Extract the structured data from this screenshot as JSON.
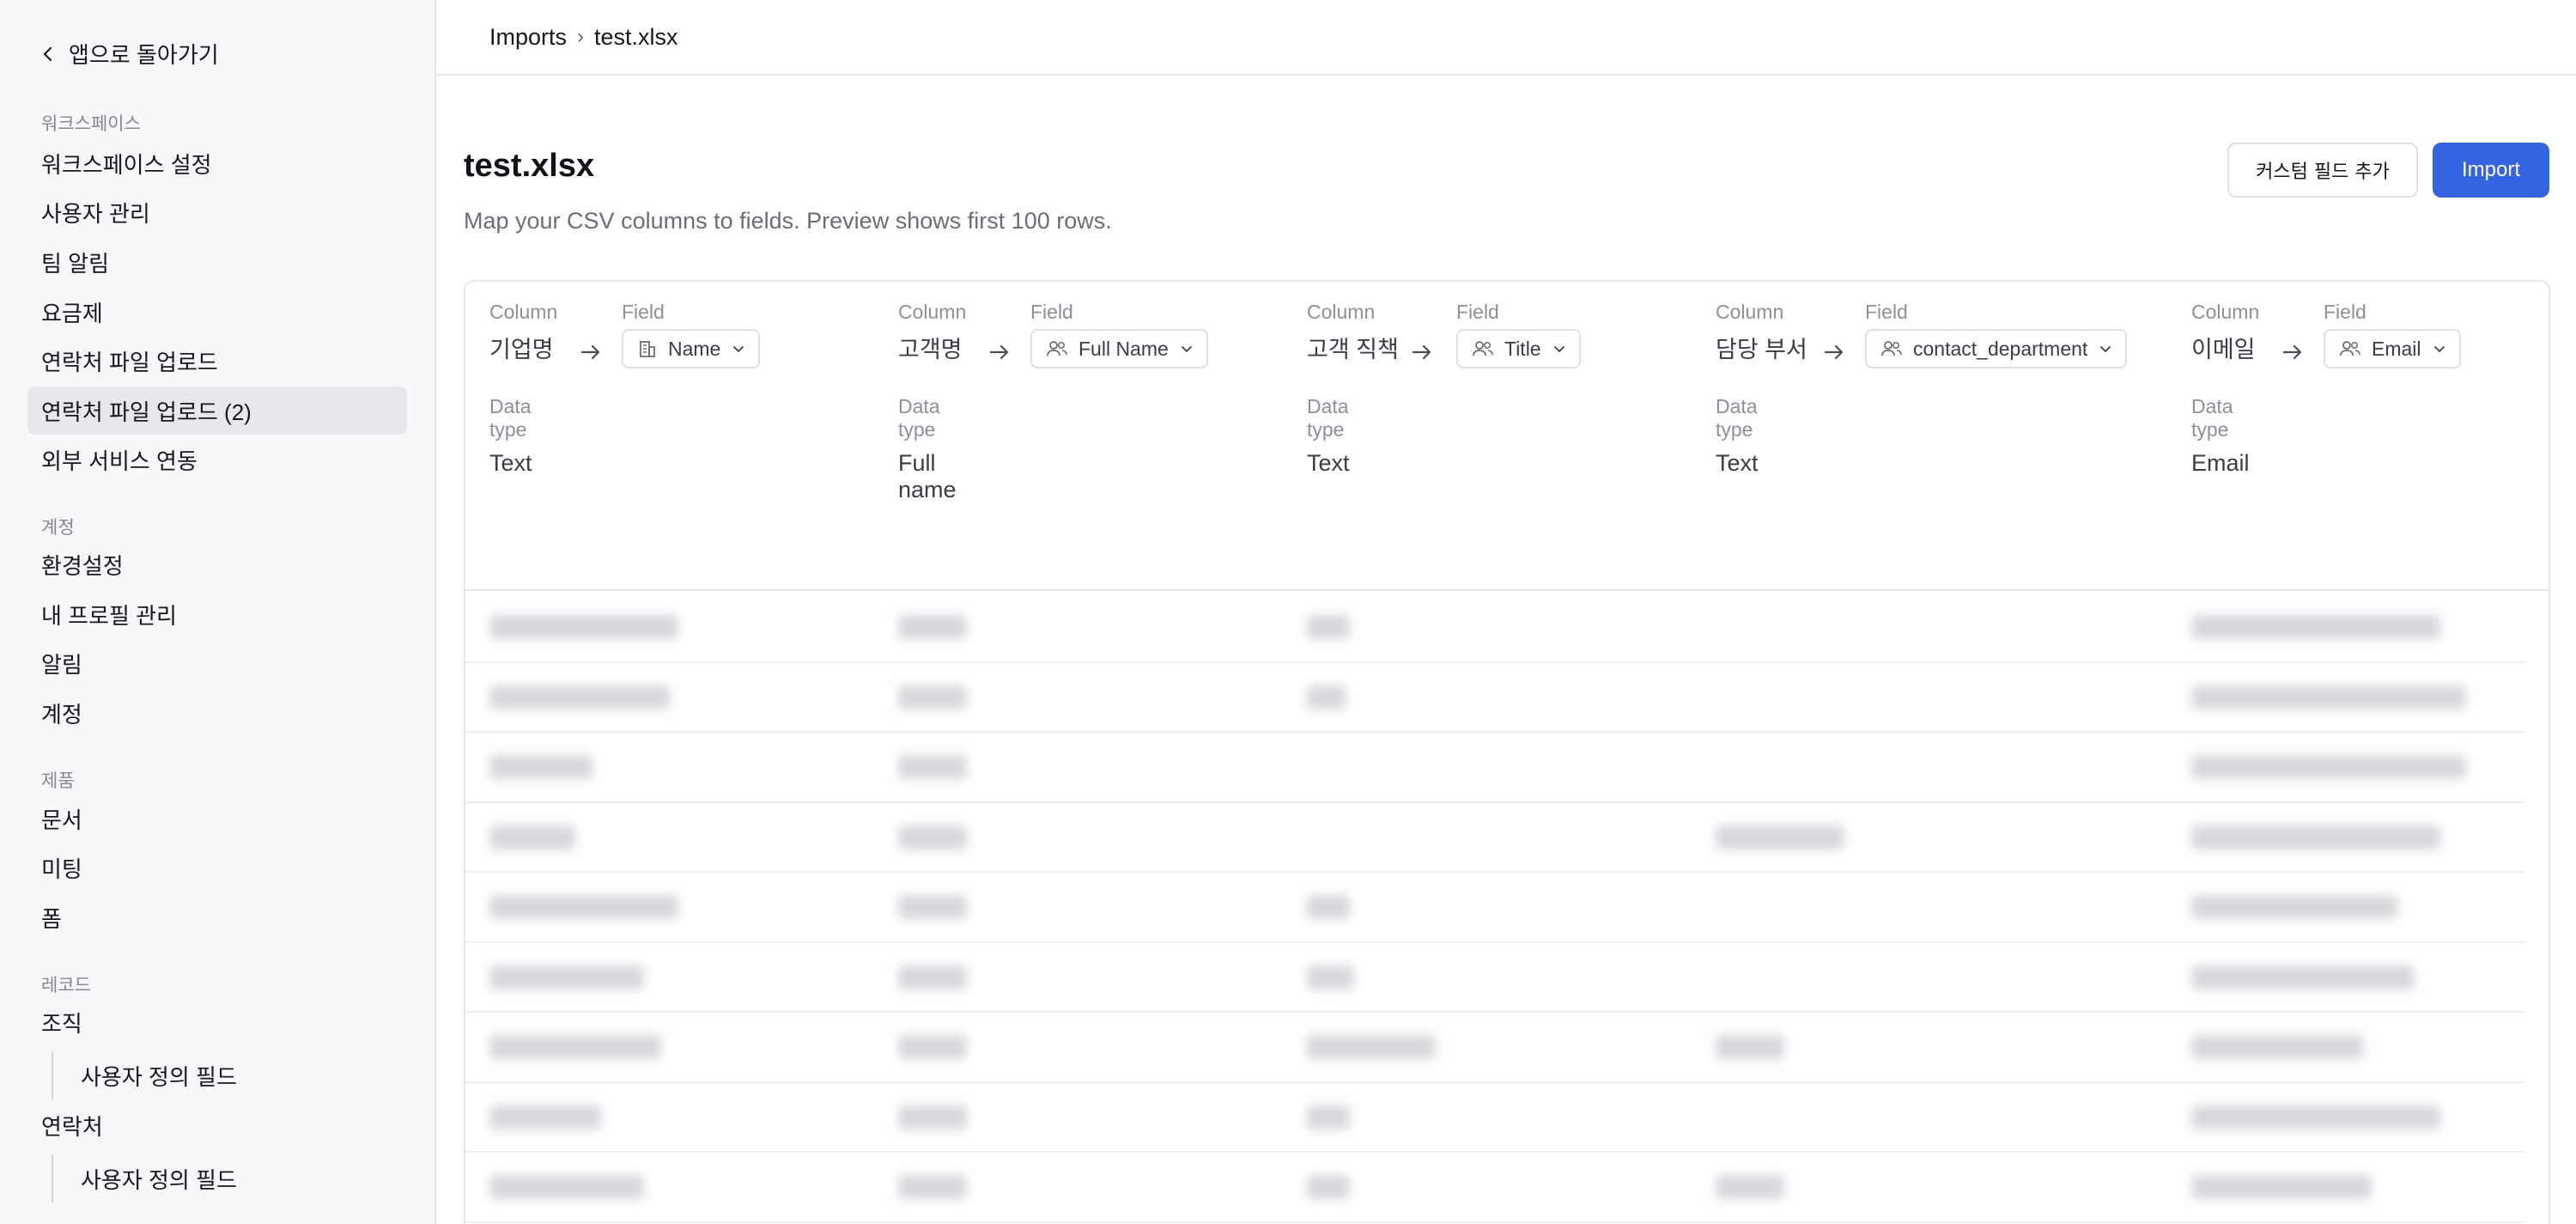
{
  "sidebar": {
    "back_label": "앱으로 돌아가기",
    "sections": [
      {
        "label": "워크스페이스",
        "items": [
          "워크스페이스 설정",
          "사용자 관리",
          "팀 알림",
          "요금제",
          "연락처 파일 업로드",
          "연락처 파일 업로드 (2)",
          "외부 서비스 연동"
        ]
      },
      {
        "label": "계정",
        "items": [
          "환경설정",
          "내 프로필 관리",
          "알림",
          "계정"
        ]
      },
      {
        "label": "제품",
        "items": [
          "문서",
          "미팅",
          "폼"
        ]
      },
      {
        "label": "레코드",
        "items": [
          "조직",
          "사용자 정의 필드",
          "연락처",
          "사용자 정의 필드"
        ]
      }
    ],
    "active_item": "연락처 파일 업로드 (2)"
  },
  "breadcrumb": {
    "root": "Imports",
    "separator": "›",
    "current": "test.xlsx"
  },
  "page": {
    "title": "test.xlsx",
    "description": "Map your CSV columns to fields. Preview shows first 100 rows.",
    "add_custom_field_label": "커스텀 필드 추가",
    "import_label": "Import"
  },
  "mapping": {
    "column_label": "Column",
    "field_label": "Field",
    "data_type_label": "Data type",
    "columns": [
      {
        "column": "기업명",
        "field": "Name",
        "field_icon": "building-icon",
        "data_type": "Text"
      },
      {
        "column": "고객명",
        "field": "Full Name",
        "field_icon": "users-icon",
        "data_type": "Full name"
      },
      {
        "column": "고객 직책",
        "field": "Title",
        "field_icon": "users-icon",
        "data_type": "Text"
      },
      {
        "column": "담당 부서",
        "field": "contact_department",
        "field_icon": "users-icon",
        "data_type": "Text"
      },
      {
        "column": "이메일",
        "field": "Email",
        "field_icon": "users-icon",
        "data_type": "Email"
      }
    ]
  },
  "preview": {
    "row_count_visible": 9,
    "blurred": true
  }
}
